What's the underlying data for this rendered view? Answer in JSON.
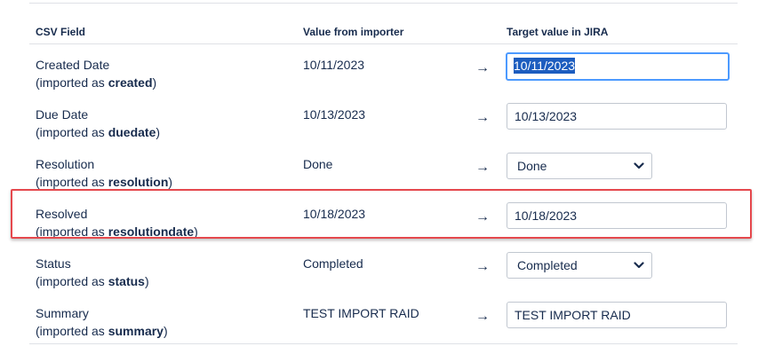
{
  "table": {
    "headers": {
      "csv_field": "CSV Field",
      "value_from_importer": "Value from importer",
      "target_value": "Target value in JIRA"
    },
    "sub_prefix": "(imported as ",
    "sub_suffix": ")",
    "arrow": "→",
    "rows": [
      {
        "field": "Created Date",
        "imported_as": "created",
        "importer_value": "10/11/2023",
        "control": "input",
        "target_value": "10/11/2023",
        "focused": true,
        "text_selected": true
      },
      {
        "field": "Due Date",
        "imported_as": "duedate",
        "importer_value": "10/13/2023",
        "control": "input",
        "target_value": "10/13/2023"
      },
      {
        "field": "Resolution",
        "imported_as": "resolution",
        "importer_value": "Done",
        "control": "select",
        "target_value": "Done"
      },
      {
        "field": "Resolved",
        "imported_as": "resolutiondate",
        "importer_value": "10/18/2023",
        "control": "input",
        "target_value": "10/18/2023",
        "highlighted": true
      },
      {
        "field": "Status",
        "imported_as": "status",
        "importer_value": "Completed",
        "control": "select",
        "target_value": "Completed"
      },
      {
        "field": "Summary",
        "imported_as": "summary",
        "importer_value": "TEST IMPORT RAID",
        "control": "input",
        "target_value": "TEST IMPORT RAID"
      }
    ]
  },
  "colors": {
    "text": "#172b4d",
    "rule": "#dfe1e6",
    "focus_border": "#4c9aff",
    "selection": "#1d5dbf",
    "highlight_border": "#e5484d"
  },
  "icons": {
    "select_arrow": "chevron-down-icon",
    "mapping_arrow": "right-arrow-icon"
  }
}
